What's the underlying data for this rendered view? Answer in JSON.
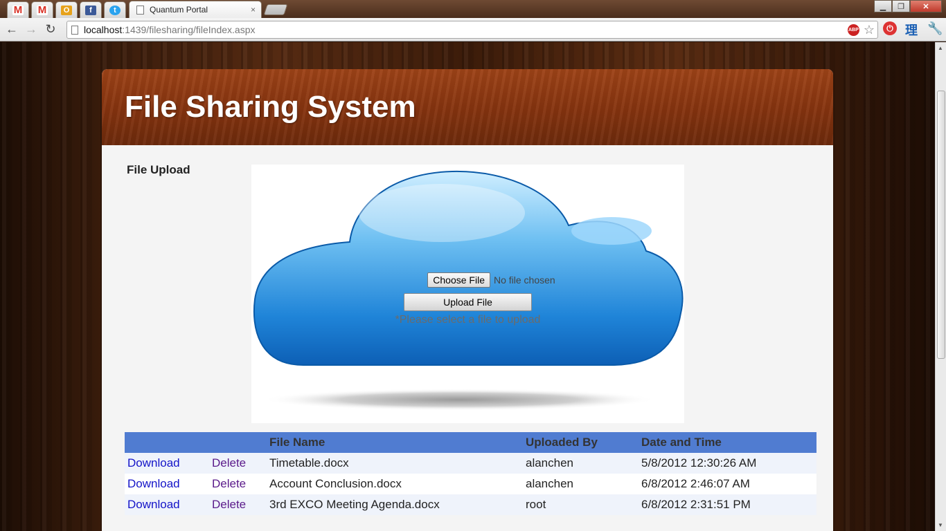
{
  "browser": {
    "tab_title": "Quantum Portal",
    "tab_close": "×",
    "url_host": "localhost",
    "url_path": ":1439/filesharing/fileIndex.aspx",
    "abp": "ABP",
    "ext_li": "理",
    "pinned_tabs": [
      {
        "icon": "gmail-icon",
        "glyph": "M"
      },
      {
        "icon": "gmail-icon",
        "glyph": "M"
      },
      {
        "icon": "outlook-icon",
        "glyph": "O"
      },
      {
        "icon": "facebook-icon",
        "glyph": "f"
      },
      {
        "icon": "twitter-icon",
        "glyph": "t"
      }
    ]
  },
  "page": {
    "title": "File Sharing System",
    "upload_label": "File Upload",
    "choose_file": "Choose File",
    "no_file": "No file chosen",
    "upload_button": "Upload File",
    "hint": "*Please select a file to upload"
  },
  "table": {
    "headers": [
      "",
      "",
      "File Name",
      "Uploaded By",
      "Date and Time"
    ],
    "rows": [
      {
        "download": "Download",
        "delete": "Delete",
        "file": "Timetable.docx",
        "user": "alanchen",
        "date": "5/8/2012 12:30:26 AM"
      },
      {
        "download": "Download",
        "delete": "Delete",
        "file": "Account Conclusion.docx",
        "user": "alanchen",
        "date": "6/8/2012 2:46:07 AM"
      },
      {
        "download": "Download",
        "delete": "Delete",
        "file": "3rd EXCO Meeting Agenda.docx",
        "user": "root",
        "date": "6/8/2012 2:31:51 PM"
      }
    ]
  },
  "colors": {
    "header_brown": "#85330f",
    "table_header": "#507cd1",
    "row_alt": "#eff3fb",
    "link": "#1414c8",
    "visited_link": "#5a1a8a"
  }
}
